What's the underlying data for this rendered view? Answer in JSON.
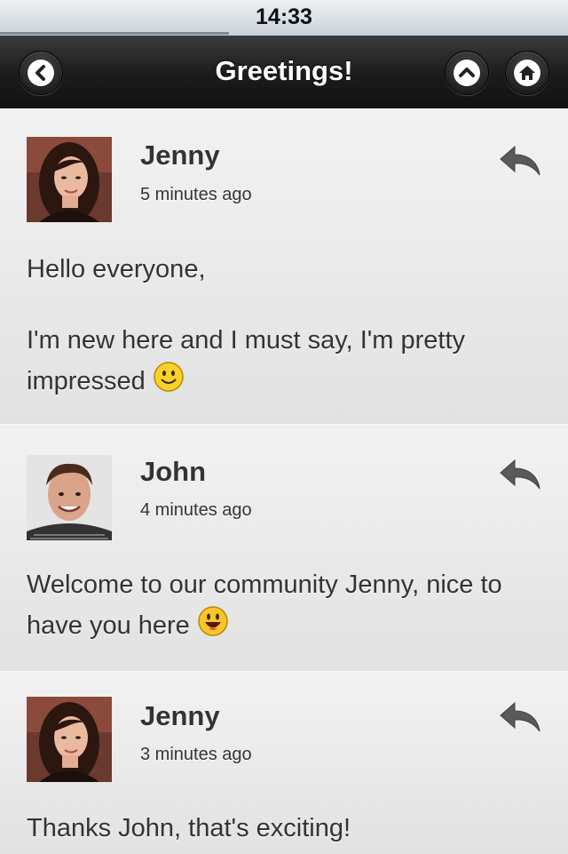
{
  "status_bar": {
    "time": "14:33"
  },
  "nav": {
    "title": "Greetings!",
    "back_icon": "chevron-left-icon",
    "scroll_top_icon": "chevron-up-icon",
    "home_icon": "home-icon"
  },
  "posts": [
    {
      "author": "Jenny",
      "time": "5 minutes ago",
      "paragraphs": [
        "Hello everyone,",
        "I'm new here and I must say, I'm pretty impressed"
      ],
      "emoji": "smile-emoji"
    },
    {
      "author": "John",
      "time": "4 minutes ago",
      "paragraphs": [
        "Welcome to our community Jenny, nice to have you here"
      ],
      "emoji": "grin-emoji"
    },
    {
      "author": "Jenny",
      "time": "3 minutes ago",
      "paragraphs": [
        "Thanks John, that's exciting!"
      ]
    }
  ]
}
